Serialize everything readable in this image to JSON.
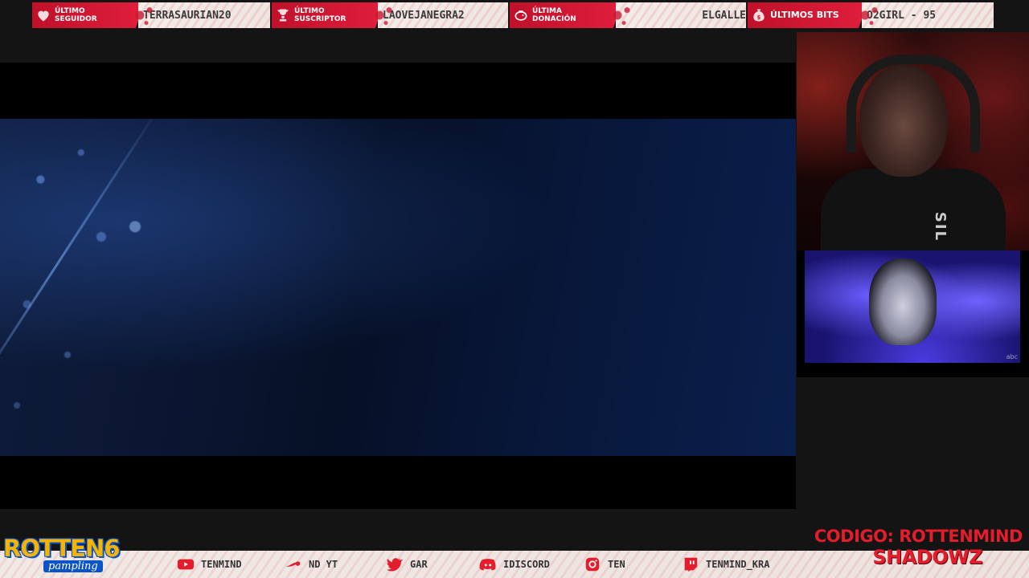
{
  "alerts": [
    {
      "label": "Último\nseguidor",
      "value": "TERRASAURIAN20",
      "icon": "heart-icon"
    },
    {
      "label": "Último\nsuscriptor",
      "value": "LAOVEJANEGRA2",
      "icon": "trophy-icon"
    },
    {
      "label": "Última\ndonación",
      "value": "ELGALLE",
      "icon": "piggy-bank-icon"
    },
    {
      "label": "Últimos bits",
      "value": "O2GIRL - 95",
      "icon": "money-bag-icon"
    }
  ],
  "webcam": {
    "shirt_text": "SIL"
  },
  "clip": {
    "network": "abc"
  },
  "ticker": [
    {
      "text": "TENMIND",
      "icon": "youtube-icon"
    },
    {
      "text": "ND YT",
      "icon": "steam-icon"
    },
    {
      "text": "GAR",
      "icon": "twitter-icon"
    },
    {
      "text": "IDISCORD",
      "icon": "discord-icon"
    },
    {
      "text": "TEN",
      "icon": "instagram-icon"
    },
    {
      "text": "TENMIND_KRA",
      "icon": "twitch-icon"
    }
  ],
  "logo": {
    "word": "ROTTEN6",
    "sub": "pampling"
  },
  "promo": {
    "code": "CODIGO: ROTTENMIND",
    "sponsor": "SHADOWZ"
  },
  "colors": {
    "accent_red": "#e01f3c",
    "promo_red": "#e41c2c",
    "logo_yellow": "#f6b400",
    "logo_blue": "#0a54c8"
  }
}
